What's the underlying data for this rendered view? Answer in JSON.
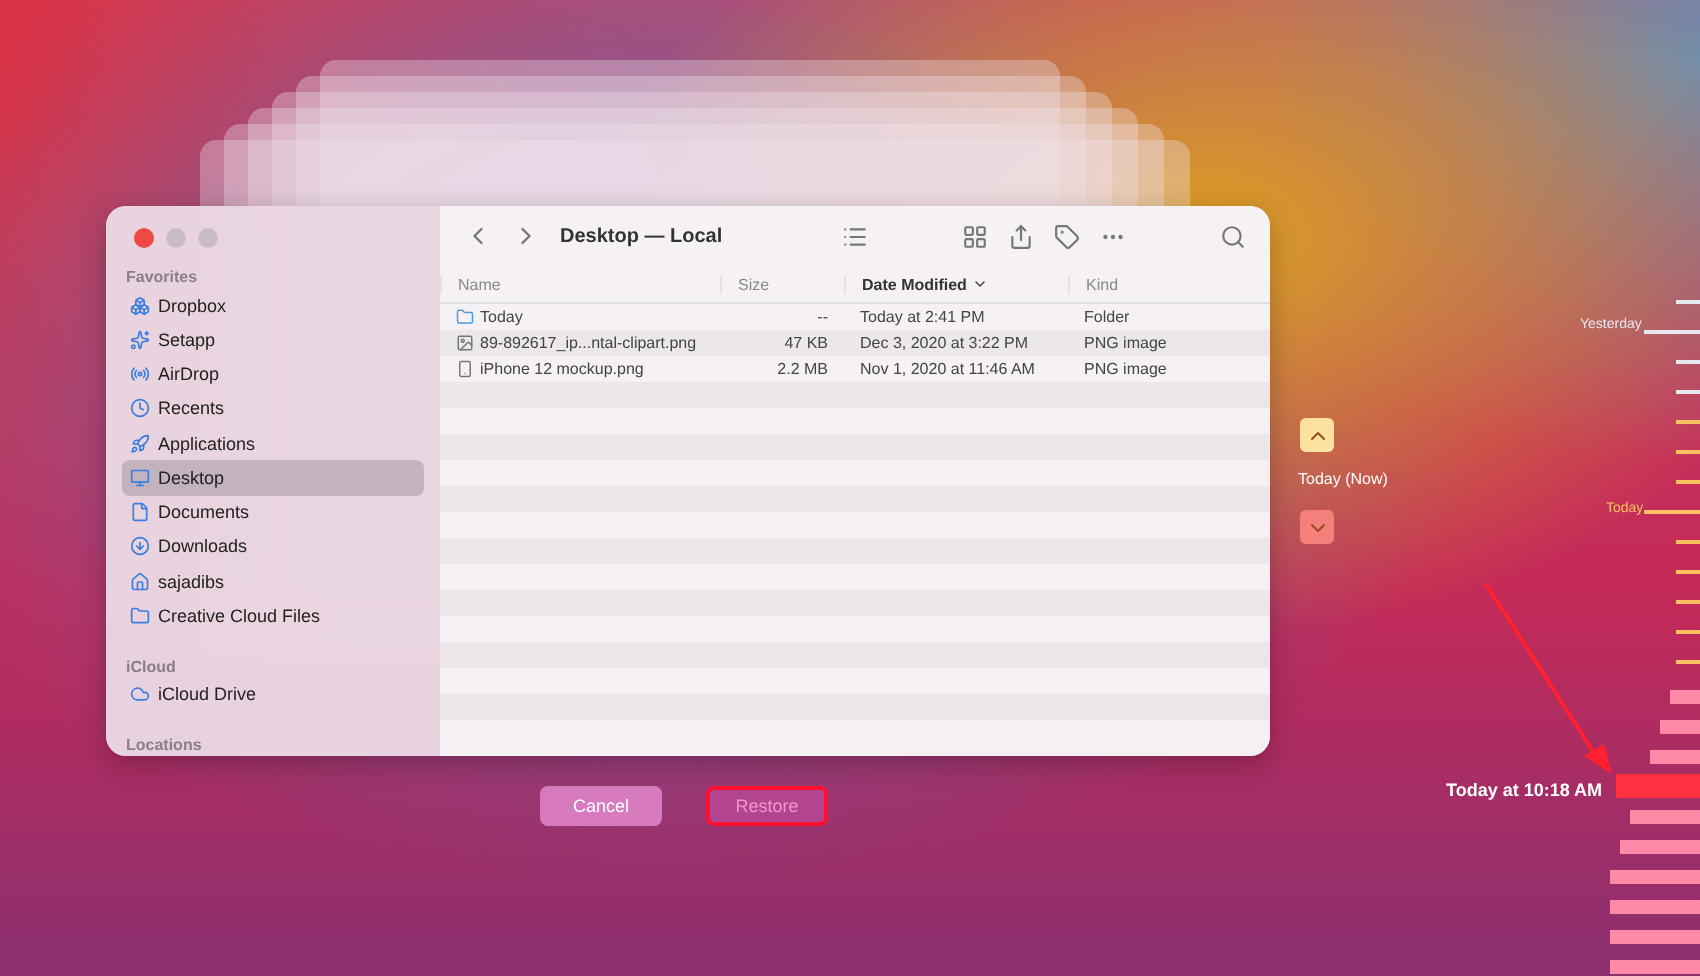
{
  "window": {
    "title": "Desktop — Local"
  },
  "sidebar": {
    "sections": [
      {
        "heading": "Favorites",
        "items": [
          {
            "label": "Dropbox",
            "selected": false
          },
          {
            "label": "Setapp",
            "selected": false
          },
          {
            "label": "AirDrop",
            "selected": false
          },
          {
            "label": "Recents",
            "selected": false
          },
          {
            "label": "Applications",
            "selected": false
          },
          {
            "label": "Desktop",
            "selected": true
          },
          {
            "label": "Documents",
            "selected": false
          },
          {
            "label": "Downloads",
            "selected": false
          },
          {
            "label": "sajadibs",
            "selected": false
          },
          {
            "label": "Creative Cloud Files",
            "selected": false
          }
        ]
      },
      {
        "heading": "iCloud",
        "items": [
          {
            "label": "iCloud Drive",
            "selected": false
          }
        ]
      },
      {
        "heading": "Locations"
      }
    ]
  },
  "table": {
    "columns": [
      {
        "label": "Name",
        "sorted": false
      },
      {
        "label": "Size",
        "sorted": false
      },
      {
        "label": "Date Modified",
        "sorted": true
      },
      {
        "label": "Kind",
        "sorted": false
      }
    ],
    "rows": [
      {
        "kind": "folder",
        "name": "Today",
        "size": "--",
        "date": "Today at 2:41 PM",
        "type": "Folder"
      },
      {
        "kind": "image",
        "name": "89-892617_ip...ntal-clipart.png",
        "size": "47 KB",
        "date": "Dec 3, 2020 at 3:22 PM",
        "type": "PNG image"
      },
      {
        "kind": "phone",
        "name": "iPhone 12 mockup.png",
        "size": "2.2 MB",
        "date": "Nov 1, 2020 at 11:46 AM",
        "type": "PNG image"
      }
    ]
  },
  "navigator": {
    "label": "Today (Now)"
  },
  "timeline": {
    "labels": [
      "Yesterday",
      "Today"
    ]
  },
  "snapshot_time": "Today at 10:18 AM",
  "buttons": [
    {
      "label": "Cancel",
      "highlighted": false,
      "disabled": false
    },
    {
      "label": "Restore",
      "highlighted": true,
      "disabled": true
    }
  ]
}
